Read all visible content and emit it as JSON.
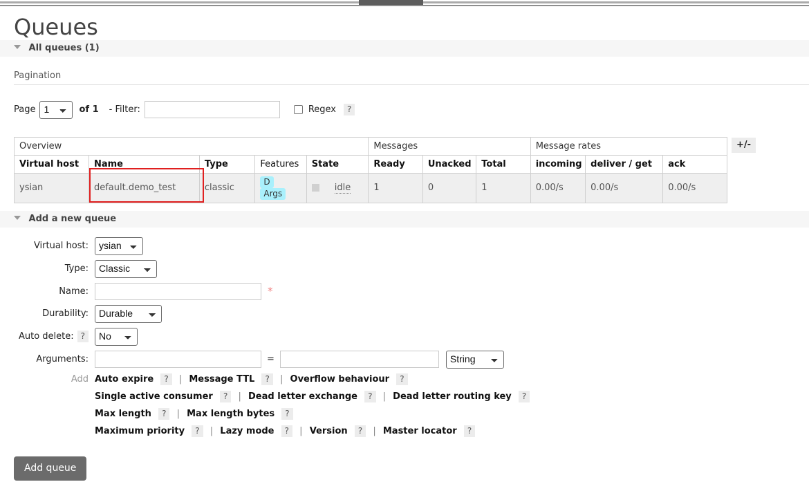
{
  "topnav": {
    "active_tab": "Queues"
  },
  "page": {
    "title": "Queues"
  },
  "sections": {
    "all_queues": {
      "label": "All queues (1)"
    },
    "add_queue": {
      "label": "Add a new queue"
    }
  },
  "pagination": {
    "legend": "Pagination",
    "page_label": "Page",
    "page_value": "1",
    "of_label": "of 1",
    "filter_label": "- Filter:",
    "filter_value": "",
    "filter_placeholder": "",
    "regex_label": "Regex",
    "regex_help": "?",
    "regex_checked": false
  },
  "table": {
    "groups": [
      {
        "label": "Overview",
        "span": 5
      },
      {
        "label": "Messages",
        "span": 3
      },
      {
        "label": "Message rates",
        "span": 3
      }
    ],
    "columns": [
      "Virtual host",
      "Name",
      "Type",
      "Features",
      "State",
      "Ready",
      "Unacked",
      "Total",
      "incoming",
      "deliver / get",
      "ack"
    ],
    "rows": [
      {
        "vhost": "ysian",
        "name": "default.demo_test",
        "type": "classic",
        "features": [
          "D",
          "Args"
        ],
        "state": "idle",
        "ready": "1",
        "unacked": "0",
        "total": "1",
        "incoming": "0.00/s",
        "deliver_get": "0.00/s",
        "ack": "0.00/s"
      }
    ],
    "toggle_columns_label": "+/-"
  },
  "add_queue_form": {
    "fields": {
      "virtual_host": {
        "label": "Virtual host:",
        "value": "ysian"
      },
      "type": {
        "label": "Type:",
        "value": "Classic"
      },
      "name": {
        "label": "Name:",
        "value": "",
        "placeholder": "",
        "required_mark": "*"
      },
      "durability": {
        "label": "Durability:",
        "value": "Durable"
      },
      "auto_delete": {
        "label": "Auto delete:",
        "help": "?",
        "value": "No"
      },
      "arguments": {
        "label": "Arguments:",
        "key_value": "",
        "equals": "=",
        "val_value": "",
        "type_value": "String"
      }
    },
    "add_label": "Add",
    "presets": [
      [
        {
          "label": "Auto expire",
          "help": "?"
        },
        {
          "label": "Message TTL",
          "help": "?"
        },
        {
          "label": "Overflow behaviour",
          "help": "?"
        }
      ],
      [
        {
          "label": "Single active consumer",
          "help": "?"
        },
        {
          "label": "Dead letter exchange",
          "help": "?"
        },
        {
          "label": "Dead letter routing key",
          "help": "?"
        }
      ],
      [
        {
          "label": "Max length",
          "help": "?"
        },
        {
          "label": "Max length bytes",
          "help": "?"
        }
      ],
      [
        {
          "label": "Maximum priority",
          "help": "?"
        },
        {
          "label": "Lazy mode",
          "help": "?"
        },
        {
          "label": "Version",
          "help": "?"
        },
        {
          "label": "Master locator",
          "help": "?"
        }
      ]
    ],
    "submit_label": "Add queue"
  },
  "colors": {
    "badge": "#a9f0fc",
    "highlight": "#e02020",
    "button": "#6b6b6b",
    "row_bg": "#efefef"
  }
}
